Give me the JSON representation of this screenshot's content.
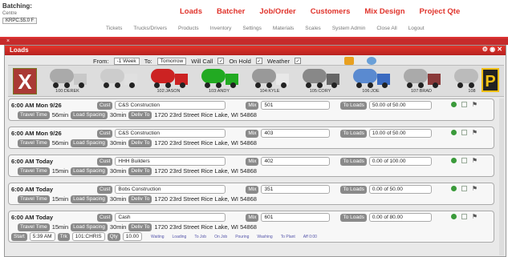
{
  "brand": {
    "title": "Batching:",
    "sub": "Centre",
    "plant": "KRPC.55.0 F"
  },
  "mainnav": [
    "Loads",
    "Batcher",
    "Job/Order",
    "Customers",
    "Mix Design",
    "Project Qte"
  ],
  "subnav": [
    "Tickets",
    "Trucks/Drivers",
    "Products",
    "Inventory",
    "Settings",
    "Materials",
    "Scales",
    "System Admin",
    "Close All",
    "Logout"
  ],
  "window": {
    "title": "Loads",
    "controls": "⚙ ◉ ✕"
  },
  "filters": {
    "from_label": "From:",
    "from_value": "-1 Week",
    "to_label": "To:",
    "to_value": "Tomorrow",
    "willcall": "Will Call",
    "onhold": "On Hold",
    "weather": "Weather"
  },
  "trucks": [
    {
      "label": "100:DEREK",
      "cab": "#c8c8c8",
      "drum": "#aaa"
    },
    {
      "label": "",
      "cab": "#e0e0e0",
      "drum": "#ccc"
    },
    {
      "label": "102:JASON",
      "cab": "#c22",
      "drum": "#c22"
    },
    {
      "label": "103:ANDY",
      "cab": "#2a2",
      "drum": "#2a2"
    },
    {
      "label": "104:KYLE",
      "cab": "#e8e8e8",
      "drum": "#999"
    },
    {
      "label": "105:CORY",
      "cab": "#666",
      "drum": "#888"
    },
    {
      "label": "106:JOE",
      "cab": "#3a6ac0",
      "drum": "#5a8ad0"
    },
    {
      "label": "107:BRAD",
      "cab": "#8a3a3a",
      "drum": "#aaa"
    },
    {
      "label": "108",
      "cab": "#ddd",
      "drum": "#bbb"
    }
  ],
  "labels": {
    "cust": "Cust",
    "mix": "Mix",
    "toloads": "To Loads",
    "travel": "Travel Time",
    "spacing": "Load Spacing",
    "deliv": "Deliv To",
    "start": "Start",
    "trk": "Trk",
    "qty": "Qty"
  },
  "tickets": [
    {
      "time": "6:00 AM Mon 9/26",
      "cust": "C&S Construction",
      "mix": "501",
      "loads": "50.00 of 50.00",
      "travel": "56min",
      "spacing": "30min",
      "deliv": "1720 23rd Street Rice Lake, WI 54868"
    },
    {
      "time": "6:00 AM Mon 9/26",
      "cust": "C&S Construction",
      "mix": "403",
      "loads": "10.00 of 50.00",
      "travel": "56min",
      "spacing": "30min",
      "deliv": "1720 23rd Street Rice Lake, WI 54868"
    },
    {
      "time": "6:00 AM Today",
      "cust": "HHH Builders",
      "mix": "402",
      "loads": "0.00 of 100.00",
      "travel": "15min",
      "spacing": "30min",
      "deliv": "1720 23rd Street Rice Lake, WI 54868"
    },
    {
      "time": "6:00 AM Today",
      "cust": "Bobs Construction",
      "mix": "351",
      "loads": "0.00 of 50.00",
      "travel": "15min",
      "spacing": "30min",
      "deliv": "1720 23rd Street Rice Lake, WI 54868"
    },
    {
      "time": "6:00 AM Today",
      "cust": "Cash",
      "mix": "601",
      "loads": "0.00 of 80.00",
      "travel": "15min",
      "spacing": "30min",
      "deliv": "1720 23rd Street Rice Lake, WI 54868"
    }
  ],
  "last": {
    "start": "5:39 AM",
    "trk": "101:CHRIS",
    "qty": "10.00",
    "progress": [
      "Waiting",
      "Loading",
      "To Job",
      "On Job",
      "Pouring",
      "Washing",
      "To Plant",
      "Aff 0:00"
    ]
  }
}
